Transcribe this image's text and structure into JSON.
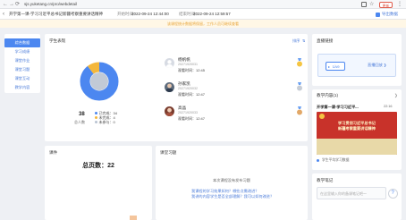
{
  "browser": {
    "url": "sjs.yuketang.cn/pro/webdetail",
    "update_label": "更新",
    "back": "←",
    "forward": "→",
    "reload": "⟳",
    "menu": "⋮"
  },
  "header": {
    "title": "开学第一课-学习习近平总书记新疆考察重要讲话精神",
    "start_label": "开始时间：",
    "start_time": "2022-09-24 12:44:00",
    "end_label": "结束时间：",
    "end_time": "2022-09-24 12:59:57",
    "export_label": "导出数据"
  },
  "notice": "该课程统计数据将保留，工作人员可继续查看",
  "sidebar": {
    "items": [
      {
        "label": "综合数据",
        "active": true
      },
      {
        "label": "学习成绩"
      },
      {
        "label": "课堂作业"
      },
      {
        "label": "课堂习题"
      },
      {
        "label": "课堂互动"
      },
      {
        "label": "教学内容"
      }
    ]
  },
  "students": {
    "title": "学生表现",
    "sort_label": "排序",
    "total": "38",
    "total_label": "总人数",
    "legend": [
      {
        "label": "已完成",
        "value": "34",
        "color": "#4c87f0"
      },
      {
        "label": "未完成",
        "value": "4",
        "color": "#f4b73b"
      },
      {
        "label": "未参与",
        "value": "0",
        "color": "#b9c3d1"
      }
    ],
    "chart_data": {
      "type": "pie",
      "categories": [
        "已完成",
        "未完成",
        "未参与"
      ],
      "values": [
        34,
        4,
        0
      ]
    },
    "time_label": "观看时间：",
    "rows": [
      {
        "name": "杨帆帆",
        "id": "20271920031",
        "time": "12:45"
      },
      {
        "name": "孙家凯",
        "id": "20271920032",
        "time": "12:47"
      },
      {
        "name": "高晶",
        "id": "20271920033",
        "time": "12:47"
      }
    ]
  },
  "links_card": {
    "title": "直播链接",
    "live_label": "Live",
    "link_text": "直播回放 ❯"
  },
  "content_card": {
    "title": "教学内容(1)",
    "more": "❯",
    "item_title": "开学第一课-学习习近平...",
    "item_duration": "22:16",
    "thumb_line1": "学习贯彻习近平总书记",
    "thumb_line2": "新疆考察重要讲话精神",
    "caption": "学生平均学习数据"
  },
  "summary": {
    "title": "课件",
    "total_label": "总页数：",
    "total_value": "22"
  },
  "exercises": {
    "title": "课堂习题",
    "empty_text": "本次课程没有发布习题",
    "questions": [
      "我课程的学习效果如何？哪些点需改进？",
      "我讲的内容学生是否全部理解？我可以如何改进？"
    ]
  },
  "comment_card": {
    "title": "教学笔记",
    "placeholder": "在这里输入你的备课笔记吧～"
  }
}
